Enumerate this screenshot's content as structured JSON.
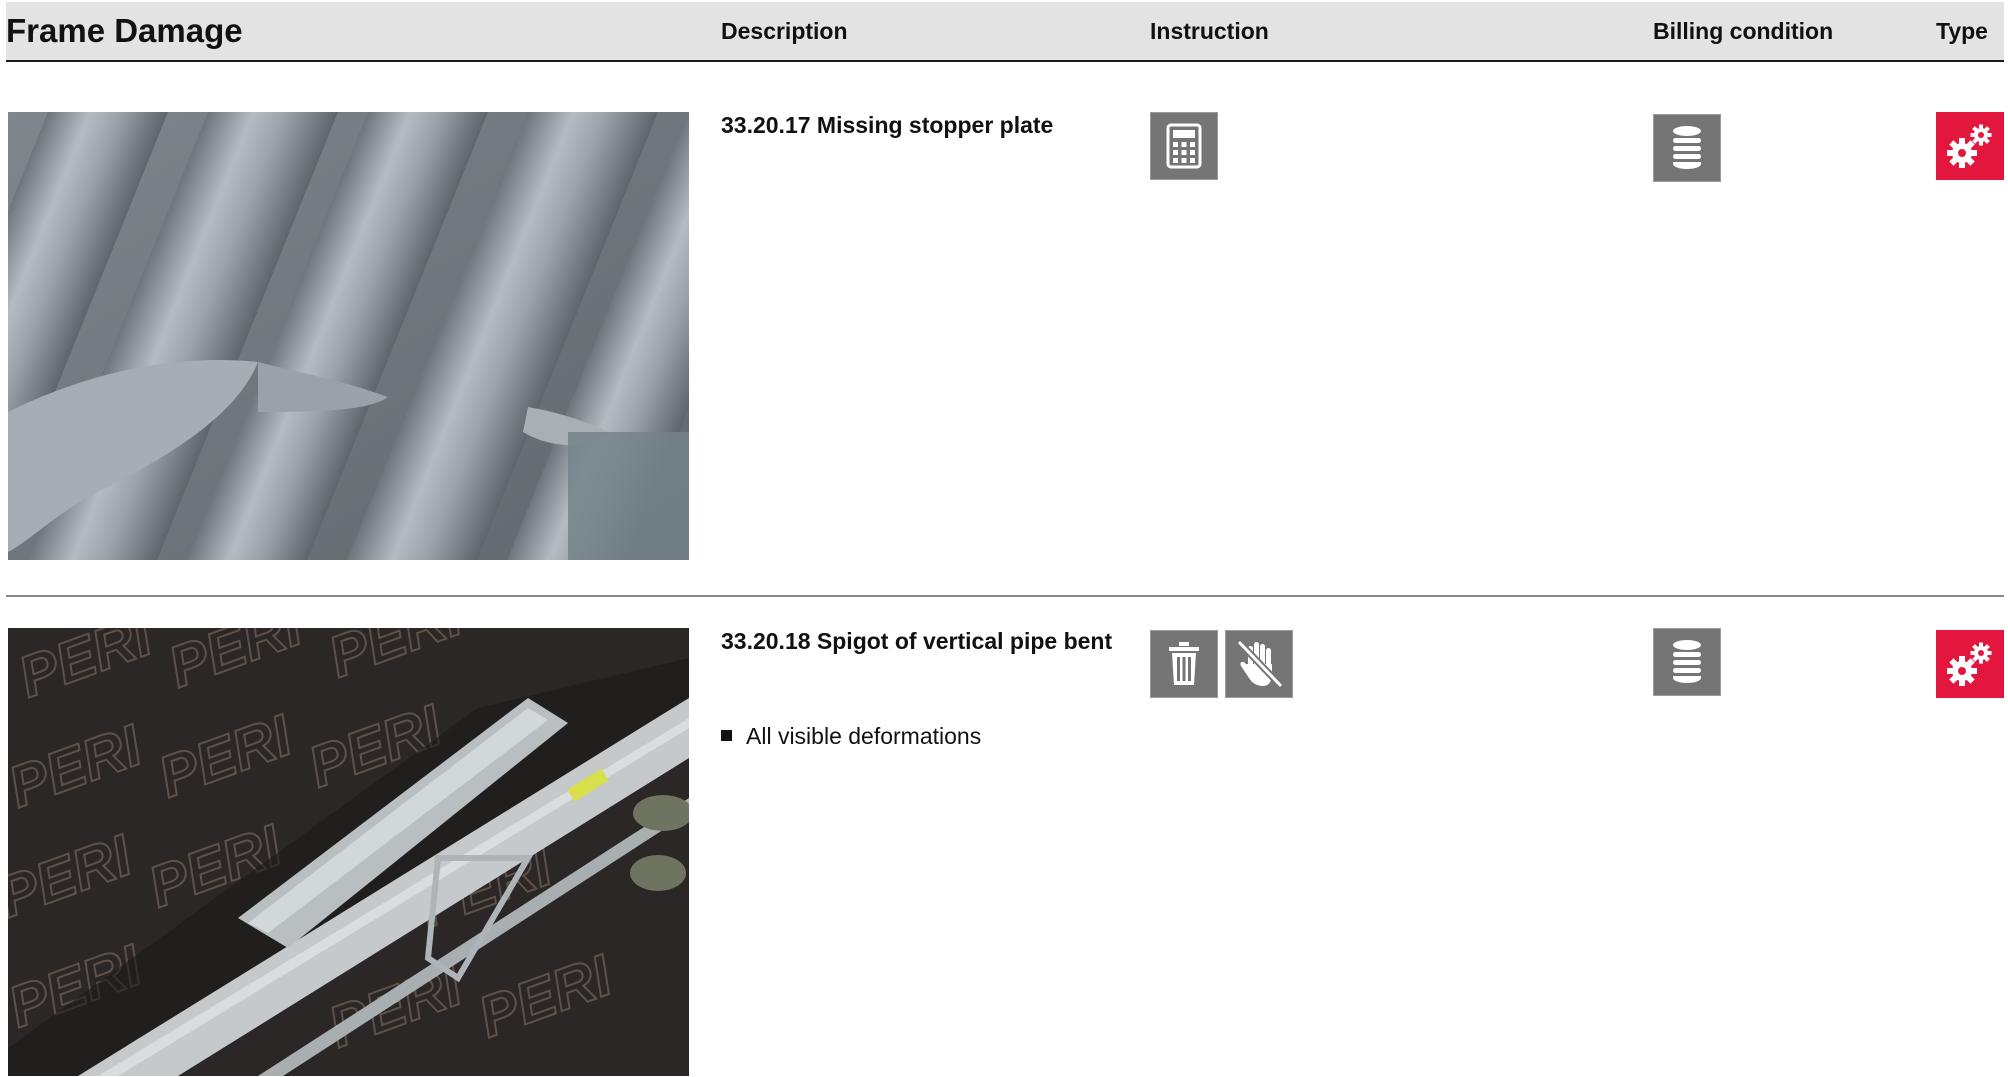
{
  "header": {
    "title": "Frame Damage",
    "description": "Description",
    "instruction": "Instruction",
    "billing_condition": "Billing condition",
    "type": "Type"
  },
  "rows": [
    {
      "title": "33.20.17 Missing stopper plate",
      "instruction_icons": [
        "calculator-icon"
      ],
      "billing_icon": "coin-stack-icon",
      "type_icon": "gears-icon",
      "bullets": []
    },
    {
      "title": "33.20.18 Spigot of vertical pipe bent",
      "instruction_icons": [
        "trash-icon",
        "no-hand-icon"
      ],
      "billing_icon": "coin-stack-icon",
      "type_icon": "gears-icon",
      "bullets": [
        "All visible deformations"
      ],
      "photo_watermark": "PERI"
    }
  ],
  "colors": {
    "header_bg": "#e3e3e3",
    "icon_gray": "#757575",
    "type_red": "#e3173e"
  }
}
